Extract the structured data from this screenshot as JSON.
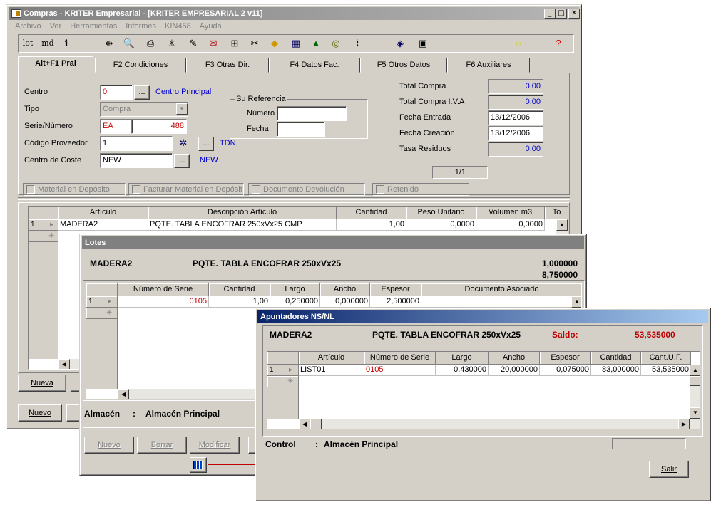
{
  "main": {
    "title": "Compras - KRITER Empresarial - [KRITER EMPRESARIAL 2 v11]",
    "menu": [
      "Archivo",
      "Ver",
      "Herramientas",
      "Informes",
      "KIN458",
      "Ayuda"
    ],
    "toolbar_text": {
      "lot": "lot",
      "md": "md"
    },
    "tabs": [
      "Alt+F1 Pral",
      "F2 Condiciones",
      "F3 Otras Dir.",
      "F4 Datos Fac.",
      "F5 Otros Datos",
      "F6 Auxiliares"
    ],
    "form": {
      "centro_label": "Centro",
      "centro_value": "0",
      "centro_name": "Centro Principal",
      "tipo_label": "Tipo",
      "tipo_value": "Compra",
      "serie_label": "Serie/Número",
      "serie_value": "EA",
      "numero_value": "488",
      "proveedor_label": "Código Proveedor",
      "proveedor_value": "1",
      "proveedor_name": "TDN",
      "coste_label": "Centro de Coste",
      "coste_value": "NEW",
      "coste_name": "NEW",
      "su_ref_label": "Su Referencia",
      "su_numero_label": "Número",
      "su_fecha_label": "Fecha",
      "total_compra_label": "Total Compra",
      "total_compra": "0,00",
      "total_iva_label": "Total Compra I.V.A",
      "total_iva": "0,00",
      "fecha_entrada_label": "Fecha Entrada",
      "fecha_entrada": "13/12/2006",
      "fecha_creacion_label": "Fecha Creación",
      "fecha_creacion": "13/12/2006",
      "tasa_label": "Tasa Residuos",
      "tasa": "0,00",
      "pager": "1/1",
      "ellipsis": "...",
      "checks": [
        "Material en Depósito",
        "Facturar Material en Depósit",
        "Documento Devolución",
        "Retenido"
      ]
    },
    "grid": {
      "headers": [
        "Artículo",
        "Descripción Artículo",
        "Cantidad",
        "Peso Unitario",
        "Volumen m3",
        "To"
      ],
      "row": {
        "num": "1",
        "articulo": "MADERA2",
        "descripcion": "PQTE. TABLA ENCOFRAR 250xVx25 CMP.",
        "cantidad": "1,00",
        "peso": "0,0000",
        "volumen": "0,0000"
      }
    },
    "buttons": {
      "nueva": "Nueva",
      "nuevo": "Nuevo"
    }
  },
  "lotes": {
    "title": "Lotes",
    "articulo": "MADERA2",
    "descripcion": "PQTE. TABLA ENCOFRAR 250xVx25",
    "val1": "1,000000",
    "val2": "8,750000",
    "headers": [
      "Número de Serie",
      "Cantidad",
      "Largo",
      "Ancho",
      "Espesor",
      "Documento Asociado"
    ],
    "row": {
      "num": "1",
      "serie": "0105",
      "cantidad": "1,00",
      "largo": "0,250000",
      "ancho": "0,000000",
      "espesor": "2,500000"
    },
    "almacen_label": "Almacén",
    "almacen_colon": ":",
    "almacen_value": "Almacén Principal",
    "buttons": {
      "nuevo": "Nuevo",
      "borrar": "Borrar",
      "modificar": "Modificar"
    }
  },
  "apuntadores": {
    "title": "Apuntadores NS/NL",
    "articulo": "MADERA2",
    "descripcion": "PQTE. TABLA ENCOFRAR 250xVx25",
    "saldo_label": "Saldo:",
    "saldo_value": "53,535000",
    "headers": [
      "Artículo",
      "Número de Serie",
      "Largo",
      "Ancho",
      "Espesor",
      "Cantidad",
      "Cant.U.F."
    ],
    "row": {
      "num": "1",
      "articulo": "LIST01",
      "serie": "0105",
      "largo": "0,430000",
      "ancho": "20,000000",
      "espesor": "0,075000",
      "cantidad": "83,000000",
      "cantuf": "53,535000"
    },
    "control_label": "Control",
    "control_colon": ":",
    "control_value": "Almacén Principal",
    "salir": "Salir"
  },
  "colors": {
    "accent_red": "#c00000",
    "link_blue": "#0000cc",
    "title_blue": "#0a246a",
    "title_gray": "#808080"
  }
}
